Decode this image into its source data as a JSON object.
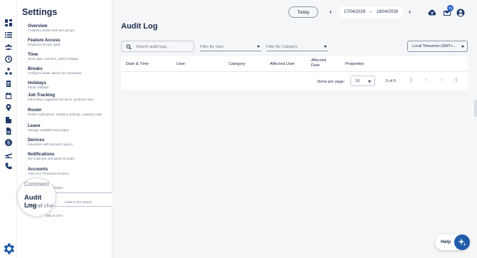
{
  "settings": {
    "title": "Settings",
    "items": [
      {
        "title": "Overview",
        "desc": "Company details and user groups"
      },
      {
        "title": "Feature Access",
        "desc": "Employee access rights"
      },
      {
        "title": "Time",
        "desc": "Work days, overtime, public holidays"
      },
      {
        "title": "Breaks",
        "desc": "Configure break options for employees"
      },
      {
        "title": "Holidays",
        "desc": "Public holidays"
      },
      {
        "title": "Job Tracking",
        "desc": "Job linking, suggested job items, geofence lock"
      },
      {
        "title": "Roster",
        "desc": "Roster notifications, invitation settings, company roles"
      },
      {
        "title": "Leave",
        "desc": "Manage available leave types"
      },
      {
        "title": "Devices",
        "desc": "Integration with biometric sign-in"
      },
      {
        "title": "Notifications",
        "desc": "Set employee and admin prompts"
      },
      {
        "title": "Accounts",
        "desc": "View your Timecloud invoices"
      }
    ],
    "partial_desc": "lization",
    "audit_desc": "made to the system",
    "last_desc": "data at once"
  },
  "magnifier": {
    "prev": "Comment",
    "title": "Audit Log",
    "desc": "View all chan"
  },
  "header": {
    "today": "Today",
    "prev_arrow": "‹",
    "next_arrow": "›",
    "date_from": "17/04/2026",
    "date_sep": "–",
    "date_to": "18/04/2026",
    "badge": "75"
  },
  "main": {
    "title": "Audit Log",
    "search_placeholder": "Search audit logs...",
    "filter_user": "Filter By User",
    "filter_category": "Filter By Category",
    "timezone": "Local Timezone (GMT+..."
  },
  "table": {
    "columns": [
      "Date & Time",
      "User",
      "Category",
      "Affected User",
      "Affected Date",
      "Properties"
    ],
    "items_per_page_label": "Items per page:",
    "items_per_page": "10",
    "range": "0 of 0"
  },
  "help": {
    "label": "Help"
  },
  "icons": {
    "rail": [
      "dashboard-icon",
      "list-icon",
      "people-icon",
      "clock-icon",
      "org-chart-icon",
      "clipboard-icon",
      "calendar-icon",
      "location-icon",
      "building-icon",
      "document-icon",
      "dollar-icon",
      "plane-icon",
      "phone-icon"
    ],
    "settings": "gear-icon"
  },
  "colors": {
    "accent": "#1f5ba8",
    "text": "#1b2a4a",
    "background": "#f5f6f8"
  }
}
